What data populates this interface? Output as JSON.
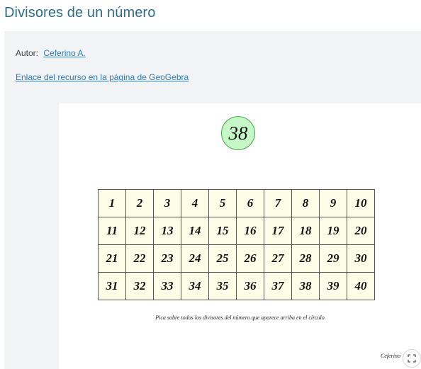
{
  "page": {
    "title": "Divisores de un número"
  },
  "meta": {
    "author_label": "Autor:",
    "author_name": "Ceferino A.",
    "resource_link": "Enlace del recurso en la página de GeoGebra"
  },
  "applet": {
    "number": "38",
    "grid": [
      [
        "1",
        "2",
        "3",
        "4",
        "5",
        "6",
        "7",
        "8",
        "9",
        "10"
      ],
      [
        "11",
        "12",
        "13",
        "14",
        "15",
        "16",
        "17",
        "18",
        "19",
        "20"
      ],
      [
        "21",
        "22",
        "23",
        "24",
        "25",
        "26",
        "27",
        "28",
        "29",
        "30"
      ],
      [
        "31",
        "32",
        "33",
        "34",
        "35",
        "36",
        "37",
        "38",
        "39",
        "40"
      ]
    ],
    "instruction": "Pica sobre todos los divisores del número que aparece arriba en el círculo",
    "credit": "Ceferino",
    "colors": {
      "circle_fill": "#c6f7c6",
      "circle_border": "#4aa24a",
      "grid_fill": "#fefde8"
    },
    "icons": {
      "fullscreen": "fullscreen-icon"
    }
  }
}
